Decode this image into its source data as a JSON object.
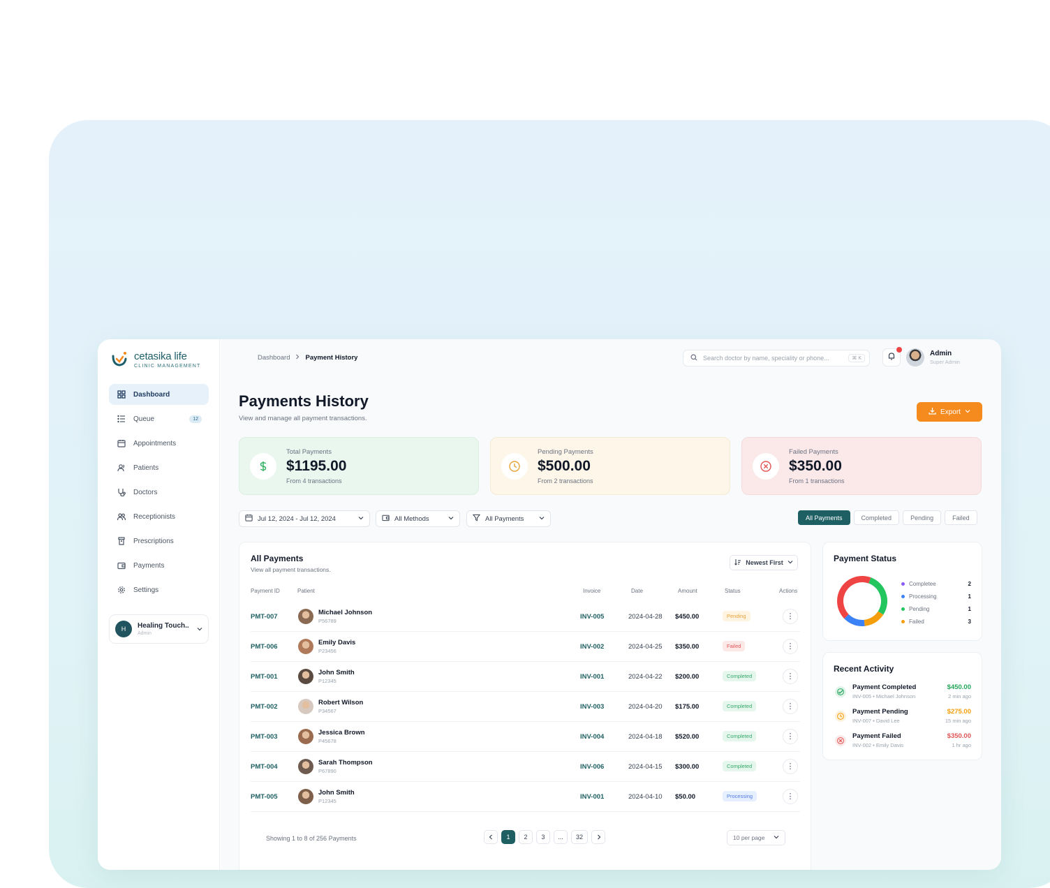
{
  "brand": {
    "name": "cetasika life",
    "tagline": "CLINIC MANAGEMENT"
  },
  "sidebar": {
    "items": [
      {
        "label": "Dashboard",
        "icon": "grid-icon",
        "active": true
      },
      {
        "label": "Queue",
        "icon": "list-icon",
        "badge": "12"
      },
      {
        "label": "Appointments",
        "icon": "calendar-icon"
      },
      {
        "label": "Patients",
        "icon": "users-icon"
      },
      {
        "label": "Doctors",
        "icon": "stethoscope-icon"
      },
      {
        "label": "Receptionists",
        "icon": "user-group-icon"
      },
      {
        "label": "Prescriptions",
        "icon": "prescription-icon"
      },
      {
        "label": "Payments",
        "icon": "wallet-icon"
      },
      {
        "label": "Settings",
        "icon": "gear-icon"
      }
    ],
    "clinic": {
      "initial": "H",
      "name": "Healing Touch..",
      "role": "Admin"
    }
  },
  "header": {
    "breadcrumb": [
      "Dashboard",
      "Payment History"
    ],
    "search_placeholder": "Search doctor by name, speciality or phone...",
    "search_shortcut": "⌘ K",
    "user": {
      "name": "Admin",
      "role": "Super Admin"
    }
  },
  "page": {
    "title": "Payments History",
    "subtitle": "View and manage all payment transactions.",
    "export_label": "Export"
  },
  "summary": [
    {
      "label": "Total Payments",
      "value": "$1195.00",
      "footer": "From 4 transactions",
      "icon": "dollar-icon",
      "color": "#2fae5f"
    },
    {
      "label": "Pending Payments",
      "value": "$500.00",
      "footer": "From 2 transactions",
      "icon": "clock-icon",
      "color": "#e8a23a"
    },
    {
      "label": "Failed Payments",
      "value": "$350.00",
      "footer": "From 1 transactions",
      "icon": "x-circle-icon",
      "color": "#e05555"
    }
  ],
  "filters": {
    "date_range": "Jul 12, 2024 - Jul 12, 2024",
    "method": "All Methods",
    "type": "All Payments",
    "tabs": [
      "All Payments",
      "Completed",
      "Pending",
      "Failed"
    ],
    "active_tab": "All Payments"
  },
  "table": {
    "title": "All Payments",
    "subtitle": "View all payment transactions.",
    "sort_label": "Newest First",
    "columns": [
      "Payment ID",
      "Patient",
      "Invoice",
      "Date",
      "Amount",
      "Status",
      "Actions"
    ],
    "rows": [
      {
        "id": "PMT-007",
        "name": "Michael Johnson",
        "code": "P56789",
        "invoice": "INV-005",
        "date": "2024-04-28",
        "amount": "$450.00",
        "status": "Pending"
      },
      {
        "id": "PMT-006",
        "name": "Emily Davis",
        "code": "P23456",
        "invoice": "INV-002",
        "date": "2024-04-25",
        "amount": "$350.00",
        "status": "Failed"
      },
      {
        "id": "PMT-001",
        "name": "John Smith",
        "code": "P12345",
        "invoice": "INV-001",
        "date": "2024-04-22",
        "amount": "$200.00",
        "status": "Completed"
      },
      {
        "id": "PMT-002",
        "name": "Robert Wilson",
        "code": "P34567",
        "invoice": "INV-003",
        "date": "2024-04-20",
        "amount": "$175.00",
        "status": "Completed"
      },
      {
        "id": "PMT-003",
        "name": "Jessica Brown",
        "code": "P45678",
        "invoice": "INV-004",
        "date": "2024-04-18",
        "amount": "$520.00",
        "status": "Completed"
      },
      {
        "id": "PMT-004",
        "name": "Sarah Thompson",
        "code": "P67890",
        "invoice": "INV-006",
        "date": "2024-04-15",
        "amount": "$300.00",
        "status": "Completed"
      },
      {
        "id": "PMT-005",
        "name": "John Smith",
        "code": "P12345",
        "invoice": "INV-001",
        "date": "2024-04-10",
        "amount": "$50.00",
        "status": "Processing"
      }
    ],
    "pagination": {
      "info": "Showing 1 to 8 of 256 Payments",
      "pages": [
        "1",
        "2",
        "3",
        "...",
        "32"
      ],
      "current": "1",
      "per_page": "10 per page"
    }
  },
  "payment_status": {
    "title": "Payment Status",
    "items": [
      {
        "label": "Completee",
        "count": "2",
        "color": "#8b5cf6"
      },
      {
        "label": "Processing",
        "count": "1",
        "color": "#3b82f6"
      },
      {
        "label": "Pending",
        "count": "1",
        "color": "#22c55e"
      },
      {
        "label": "Failed",
        "count": "3",
        "color": "#f59e0b"
      }
    ]
  },
  "chart_data": {
    "type": "pie",
    "categories": [
      "Completee",
      "Processing",
      "Pending",
      "Failed"
    ],
    "values": [
      2,
      1,
      1,
      3
    ]
  },
  "recent_activity": {
    "title": "Recent Activity",
    "items": [
      {
        "title": "Payment Completed",
        "sub": "INV-005 • Michael Johnson",
        "amount": "$450.00",
        "time": "2 min ago",
        "color": "#22a55a",
        "icon": "check-circle-icon"
      },
      {
        "title": "Payment Pending",
        "sub": "INV-007 • David Lee",
        "amount": "$275.00",
        "time": "15 min ago",
        "color": "#f59e0b",
        "icon": "clock-icon"
      },
      {
        "title": "Payment Failed",
        "sub": "INV-002 • Emily Davis",
        "amount": "$350.00",
        "time": "1 hr ago",
        "color": "#e05555",
        "icon": "x-circle-icon"
      }
    ]
  }
}
